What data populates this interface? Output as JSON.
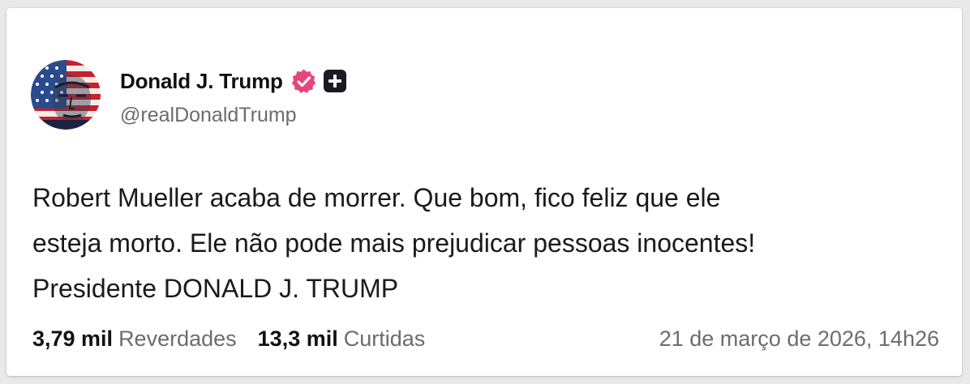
{
  "account": {
    "display_name": "Donald J. Trump",
    "handle": "@realDonaldTrump",
    "avatar_icon": "flag-portrait-avatar",
    "verified_icon": "verified-badge-icon",
    "verified_color": "#e8457a",
    "plus_icon": "plus-square-icon"
  },
  "post": {
    "lines": [
      "Robert Mueller acaba de morrer. Que bom, fico feliz que ele",
      "esteja morto. Ele não pode mais prejudicar pessoas inocentes!",
      "Presidente DONALD J. TRUMP"
    ]
  },
  "stats": {
    "reposts_count": "3,79 mil",
    "reposts_label": "Reverdades",
    "likes_count": "13,3 mil",
    "likes_label": "Curtidas"
  },
  "timestamp": "21 de março de 2026, 14h26"
}
